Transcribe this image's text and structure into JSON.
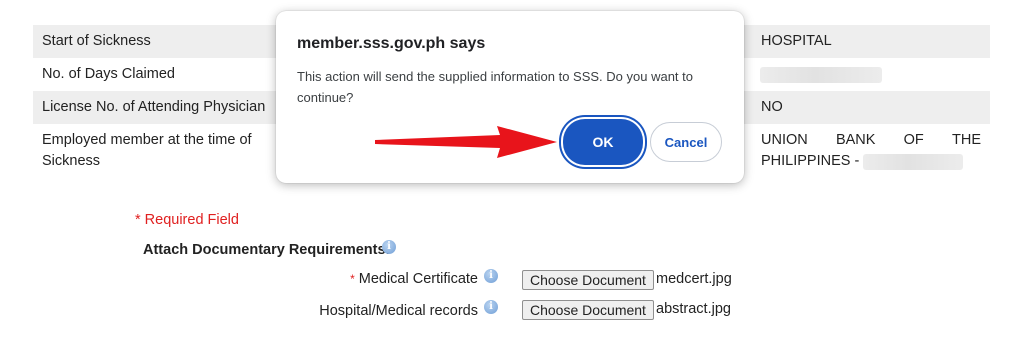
{
  "form": {
    "rows": [
      {
        "label": "Start of Sickness",
        "value": "HOSPITAL"
      },
      {
        "label": "No. of Days Claimed",
        "value": ""
      },
      {
        "label": "License No. of Attending Physician",
        "value": "NO"
      },
      {
        "label_line1": "Employed member at the time of",
        "label_line2": "Sickness",
        "value_words": [
          "UNION",
          "BANK",
          "OF",
          "THE"
        ],
        "value_line2": "PHILIPPINES -"
      }
    ]
  },
  "requirements": {
    "required_note": "* Required Field",
    "attach_title": "Attach Documentary Requirements:",
    "docs": [
      {
        "required_mark": "*",
        "label": "Medical Certificate",
        "button": "Choose Document",
        "file": "medcert.jpg"
      },
      {
        "required_mark": "",
        "label": "Hospital/Medical records",
        "button": "Choose Document",
        "file": "abstract.jpg"
      }
    ]
  },
  "dialog": {
    "title": "member.sss.gov.ph says",
    "message": "This action will send the supplied information to SSS. Do you want to continue?",
    "ok_label": "OK",
    "cancel_label": "Cancel"
  },
  "icons": {
    "info": "info-icon",
    "arrow": "red-arrow-annotation"
  },
  "colors": {
    "required": "#e02020",
    "primary": "#1a56c0",
    "row_shade": "#eeeeee",
    "arrow": "#e8141b"
  }
}
